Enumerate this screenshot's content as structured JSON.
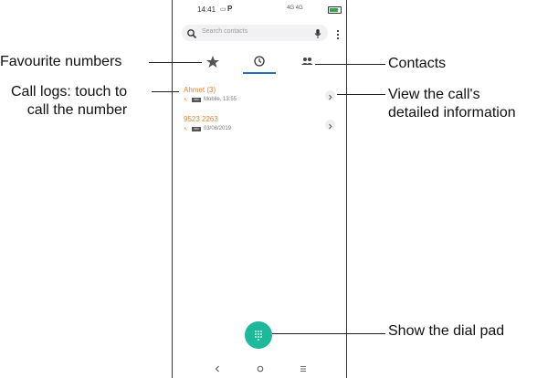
{
  "status": {
    "time": "14:41",
    "p_badge": "P",
    "network": "4G 4G"
  },
  "search": {
    "placeholder": "Search contacts"
  },
  "tabs": [
    {
      "name": "favourites",
      "icon": "star-icon"
    },
    {
      "name": "recents",
      "icon": "clock-icon",
      "selected": true
    },
    {
      "name": "contacts",
      "icon": "people-icon"
    }
  ],
  "calls": [
    {
      "name": "Ahmet (3)",
      "detail": "Mobile, 13:55",
      "sim": "SIM"
    },
    {
      "name": "9523 2263",
      "detail": "03/08/2019",
      "sim": "SIM"
    }
  ],
  "callouts": {
    "favourites": "Favourite numbers",
    "call_logs_line1": "Call logs: touch to",
    "call_logs_line2": "call the number",
    "contacts": "Contacts",
    "view_line1": "View the call's",
    "view_line2": "detailed information",
    "dial": "Show the dial pad"
  },
  "colors": {
    "accent": "#1f6fc3",
    "call_name": "#e2843a",
    "fab": "#1db99a"
  }
}
